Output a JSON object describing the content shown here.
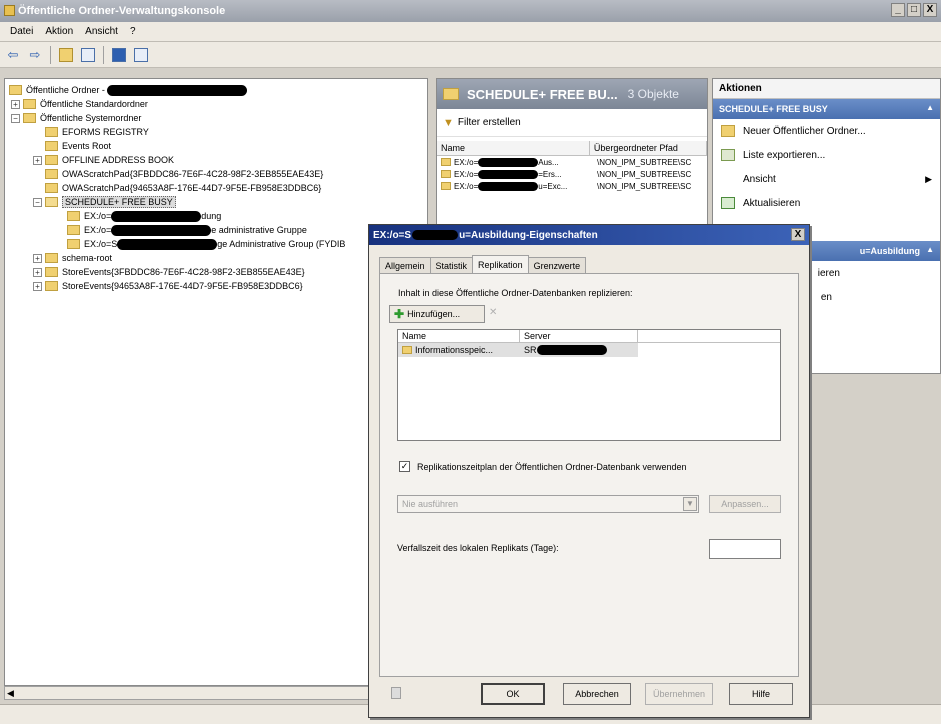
{
  "window": {
    "title": "Öffentliche Ordner-Verwaltungskonsole",
    "buttons": [
      "_",
      "□",
      "X"
    ]
  },
  "menubar": [
    "Datei",
    "Aktion",
    "Ansicht",
    "?"
  ],
  "tree": {
    "root": "Öffentliche Ordner - ",
    "standard": "Öffentliche Standardordner",
    "system": "Öffentliche Systemordner",
    "eforms": "EFORMS REGISTRY",
    "events_root": "Events Root",
    "offline_ab": "OFFLINE ADDRESS BOOK",
    "owa1": "OWAScratchPad{3FBDDC86-7E6F-4C28-98F2-3EB855EAE43E}",
    "owa2": "OWAScratchPad{94653A8F-176E-44D7-9F5E-FB958E3DDBC6}",
    "schedule": "SCHEDULE+ FREE BUSY",
    "ex1_pre": "EX:/o=",
    "ex1_post": "dung",
    "ex2_pre": "EX:/o=",
    "ex2_post": "e administrative Gruppe",
    "ex3_pre": "EX:/o=S",
    "ex3_post": "ge Administrative Group (FYDIB",
    "schema_root": "schema-root",
    "store1": "StoreEvents{3FBDDC86-7E6F-4C28-98F2-3EB855EAE43E}",
    "store2": "StoreEvents{94653A8F-176E-44D7-9F5E-FB958E3DDBC6}"
  },
  "middle": {
    "title": "SCHEDULE+ FREE BU...",
    "count": "3 Objekte",
    "filter": "Filter erstellen",
    "col_name": "Name",
    "col_path": "Übergeordneter Pfad",
    "rows": [
      {
        "name_pre": "EX:/o=",
        "name_post": "Aus...",
        "path": "\\NON_IPM_SUBTREE\\SC"
      },
      {
        "name_pre": "EX:/o=",
        "name_post": "=Ers...",
        "path": "\\NON_IPM_SUBTREE\\SC"
      },
      {
        "name_pre": "EX:/o=",
        "name_post": "u=Exc...",
        "path": "\\NON_IPM_SUBTREE\\SC"
      }
    ]
  },
  "actions": {
    "header": "Aktionen",
    "section1": "SCHEDULE+ FREE BUSY",
    "new_folder": "Neuer Öffentlicher Ordner...",
    "export_list": "Liste exportieren...",
    "view": "Ansicht",
    "refresh": "Aktualisieren",
    "section2": "u=Ausbildung",
    "partial1": "ieren",
    "partial2": "en"
  },
  "dialog": {
    "title_pre": "EX:/o=S",
    "title_post": "u=Ausbildung-Eigenschaften",
    "close": "X",
    "tabs": [
      "Allgemein",
      "Statistik",
      "Replikation",
      "Grenzwerte"
    ],
    "replicate_label": "Inhalt in diese Öffentliche Ordner-Datenbanken replizieren:",
    "add_button": "Hinzufügen...",
    "delete_button": "✕",
    "list_col_name": "Name",
    "list_col_server": "Server",
    "list_row_name": "Informationsspeic...",
    "list_row_server": "SR",
    "checkbox_label": "Replikationszeitplan der Öffentlichen Ordner-Datenbank verwenden",
    "checkbox_checked": "✓",
    "schedule_value": "Nie ausführen",
    "adjust_button": "Anpassen...",
    "retention_label": "Verfallszeit des lokalen Replikats (Tage):",
    "retention_value": "",
    "ok": "OK",
    "cancel": "Abbrechen",
    "apply": "Übernehmen",
    "help": "Hilfe"
  }
}
